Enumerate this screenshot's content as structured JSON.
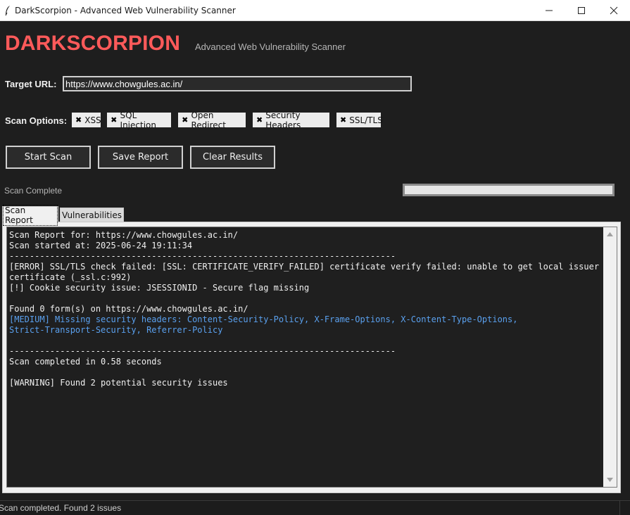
{
  "window": {
    "title": "DarkScorpion - Advanced Web Vulnerability Scanner",
    "icons": [
      "feather-icon",
      "minimize-icon",
      "maximize-icon",
      "close-icon"
    ]
  },
  "header": {
    "brand": "DARKSCORPION",
    "subtitle": "Advanced Web Vulnerability Scanner",
    "brand_color": "#ff5a5a"
  },
  "target": {
    "label": "Target URL:",
    "value": "https://www.chowgules.ac.in/"
  },
  "options": {
    "label": "Scan Options:",
    "items": [
      {
        "label": "XSS",
        "checked": true
      },
      {
        "label": "SQL Injection",
        "checked": true
      },
      {
        "label": "Open Redirect",
        "checked": true
      },
      {
        "label": "Security Headers",
        "checked": true
      },
      {
        "label": "SSL/TLS",
        "checked": true
      }
    ],
    "check_mark": "✖"
  },
  "buttons": {
    "start": "Start Scan",
    "save": "Save Report",
    "clear": "Clear Results"
  },
  "status": {
    "text": "Scan Complete",
    "progress": 1.0
  },
  "tabs": [
    {
      "label": "Scan Report",
      "active": true
    },
    {
      "label": "Vulnerabilities",
      "active": false
    }
  ],
  "report": {
    "lines": [
      "Scan Report for: https://www.chowgules.ac.in/",
      "Scan started at: 2025-06-24 19:11:34",
      "----------------------------------------------------------------------------",
      "[ERROR] SSL/TLS check failed: [SSL: CERTIFICATE_VERIFY_FAILED] certificate verify failed: unable to get local issuer",
      "certificate (_ssl.c:992)",
      "[!] Cookie security issue: JSESSIONID - Secure flag missing",
      "",
      "Found 0 form(s) on https://www.chowgules.ac.in/"
    ],
    "medium_lines": [
      "[MEDIUM] Missing security headers: Content-Security-Policy, X-Frame-Options, X-Content-Type-Options,",
      "Strict-Transport-Security, Referrer-Policy"
    ],
    "tail_lines": [
      "",
      "----------------------------------------------------------------------------",
      "Scan completed in 0.58 seconds",
      "",
      "[WARNING] Found 2 potential security issues"
    ],
    "medium_color": "#5aa0ee"
  },
  "statusbar": {
    "text": "Scan completed. Found 2 issues"
  }
}
